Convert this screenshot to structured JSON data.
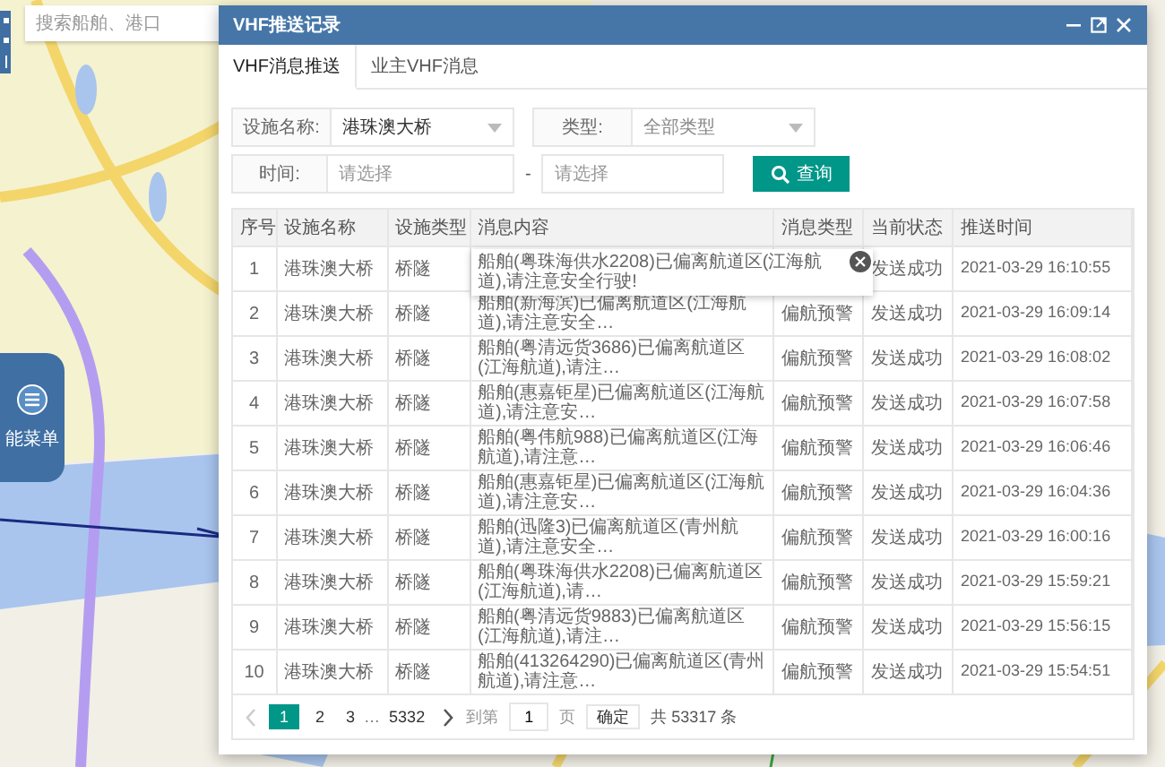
{
  "search": {
    "placeholder": "搜索船舶、港口"
  },
  "side_menu": {
    "label": "能菜单"
  },
  "dialog": {
    "title": "VHF推送记录",
    "tabs": [
      {
        "label": "VHF消息推送",
        "selected": true
      },
      {
        "label": "业主VHF消息",
        "selected": false
      }
    ],
    "filters": {
      "facility_label": "设施名称:",
      "facility_value": "港珠澳大桥",
      "type_label": "类型:",
      "type_value": "全部类型",
      "time_label": "时间:",
      "start_placeholder": "请选择",
      "separator": "-",
      "end_placeholder": "请选择",
      "query_button": "查询"
    },
    "table": {
      "columns": [
        "序号",
        "设施名称",
        "设施类型",
        "消息内容",
        "消息类型",
        "当前状态",
        "推送时间"
      ],
      "rows": [
        {
          "no": "1",
          "facility": "港珠澳大桥",
          "facility_type": "桥隧",
          "message": "船舶(粤珠海供水2208)已偏离航道区(江海航道),请注意安全行驶!",
          "status": "发送成功",
          "time": "2021-03-29 16:10:55",
          "expanded": true
        },
        {
          "no": "2",
          "facility": "港珠澳大桥",
          "facility_type": "桥隧",
          "message": "船舶(新海滨)已偏离航道区(江海航道),请注意安全…",
          "message_type": "偏航预警",
          "status": "发送成功",
          "time": "2021-03-29 16:09:14",
          "expanded": false
        },
        {
          "no": "3",
          "facility": "港珠澳大桥",
          "facility_type": "桥隧",
          "message": "船舶(粤清远货3686)已偏离航道区(江海航道),请注…",
          "message_type": "偏航预警",
          "status": "发送成功",
          "time": "2021-03-29 16:08:02",
          "expanded": false
        },
        {
          "no": "4",
          "facility": "港珠澳大桥",
          "facility_type": "桥隧",
          "message": "船舶(惠嘉钜星)已偏离航道区(江海航道),请注意安…",
          "message_type": "偏航预警",
          "status": "发送成功",
          "time": "2021-03-29 16:07:58",
          "expanded": false
        },
        {
          "no": "5",
          "facility": "港珠澳大桥",
          "facility_type": "桥隧",
          "message": "船舶(粤伟航988)已偏离航道区(江海航道),请注意…",
          "message_type": "偏航预警",
          "status": "发送成功",
          "time": "2021-03-29 16:06:46",
          "expanded": false
        },
        {
          "no": "6",
          "facility": "港珠澳大桥",
          "facility_type": "桥隧",
          "message": "船舶(惠嘉钜星)已偏离航道区(江海航道),请注意安…",
          "message_type": "偏航预警",
          "status": "发送成功",
          "time": "2021-03-29 16:04:36",
          "expanded": false
        },
        {
          "no": "7",
          "facility": "港珠澳大桥",
          "facility_type": "桥隧",
          "message": "船舶(迅隆3)已偏离航道区(青州航道),请注意安全…",
          "message_type": "偏航预警",
          "status": "发送成功",
          "time": "2021-03-29 16:00:16",
          "expanded": false
        },
        {
          "no": "8",
          "facility": "港珠澳大桥",
          "facility_type": "桥隧",
          "message": "船舶(粤珠海供水2208)已偏离航道区(江海航道),请…",
          "message_type": "偏航预警",
          "status": "发送成功",
          "time": "2021-03-29 15:59:21",
          "expanded": false
        },
        {
          "no": "9",
          "facility": "港珠澳大桥",
          "facility_type": "桥隧",
          "message": "船舶(粤清远货9883)已偏离航道区(江海航道),请注…",
          "message_type": "偏航预警",
          "status": "发送成功",
          "time": "2021-03-29 15:56:15",
          "expanded": false
        },
        {
          "no": "10",
          "facility": "港珠澳大桥",
          "facility_type": "桥隧",
          "message": "船舶(413264290)已偏离航道区(青州航道),请注意…",
          "message_type": "偏航预警",
          "status": "发送成功",
          "time": "2021-03-29 15:54:51",
          "expanded": false
        }
      ]
    },
    "pagination": {
      "prev": {
        "disabled": true
      },
      "pages": [
        {
          "kind": "page",
          "label": "1",
          "selected": true
        },
        {
          "kind": "page",
          "label": "2",
          "selected": false
        },
        {
          "kind": "page",
          "label": "3",
          "selected": false
        },
        {
          "kind": "ellipsis",
          "label": "…"
        },
        {
          "kind": "page",
          "label": "5332",
          "selected": false
        }
      ],
      "next": {
        "disabled": false
      },
      "goto_label": "到第",
      "goto_value": "1",
      "page_unit": "页",
      "confirm_button": "确定",
      "total": "共 53317 条"
    }
  }
}
